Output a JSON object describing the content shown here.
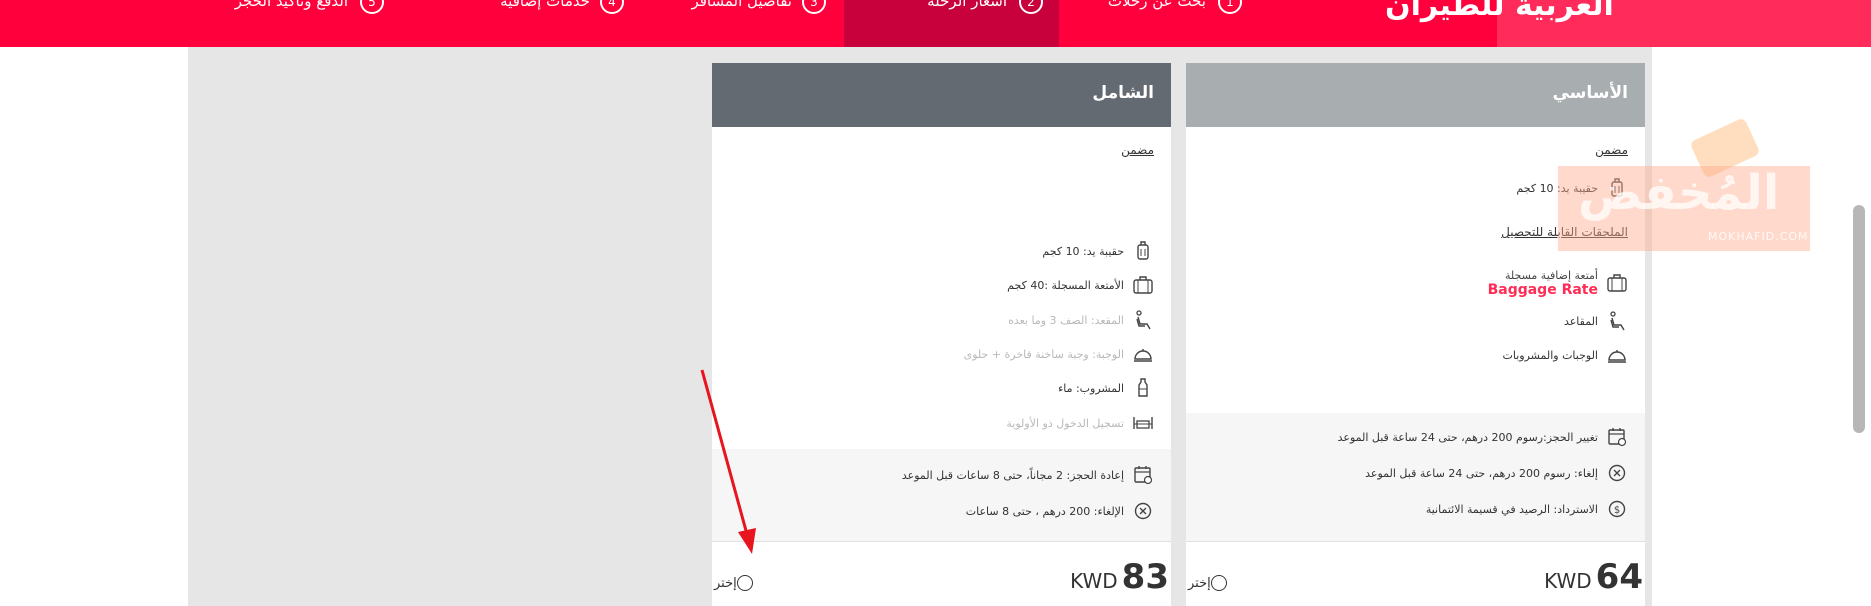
{
  "header": {
    "logo_text": "العربية للطيران",
    "steps": [
      {
        "num": "1",
        "label": "بحث عن رحلات"
      },
      {
        "num": "2",
        "label": "أسعار الرحلة"
      },
      {
        "num": "3",
        "label": "تفاصيل المسافر"
      },
      {
        "num": "4",
        "label": "خدمات إضافية"
      },
      {
        "num": "5",
        "label": "الدفع وتأكيد الحجز"
      }
    ]
  },
  "cards": {
    "inclusive": {
      "title": "الشامل",
      "included_title": "مضمن",
      "items": [
        {
          "icon": "carry-on-bag-icon",
          "label": "حقيبة يد: 10 كجم"
        },
        {
          "icon": "checked-luggage-icon",
          "label": "الأمتعة المسجلة :40 كجم"
        },
        {
          "icon": "seat-icon",
          "label": "المقعد: الصف 3 وما بعده"
        },
        {
          "icon": "meal-cloche-icon",
          "label": "الوجبة: وجبة ساخنة فاخرة + حلوى"
        },
        {
          "icon": "bottle-icon",
          "label": "المشروب: ماء"
        },
        {
          "icon": "priority-checkin-icon",
          "label": "تسجيل الدخول ذو الأولوية"
        }
      ],
      "policies": [
        {
          "icon": "calendar-change-icon",
          "label": "إعادة الحجز: 2 مجاناً، حتى 8 ساعات قبل الموعد"
        },
        {
          "icon": "cancel-circle-icon",
          "label": "الإلغاء: 200 درهم ، حتى 8 ساعات"
        }
      ],
      "price_amount": "83",
      "currency": "KWD",
      "choose_label": "إختر"
    },
    "basic": {
      "title": "الأساسي",
      "included_title": "مضمن",
      "items": [
        {
          "icon": "carry-on-bag-icon",
          "label": "حقيبة يد: 10 كجم"
        }
      ],
      "addons_title": "الملحقات القابلة للتحصيل",
      "addons": [
        {
          "icon": "checked-luggage-icon",
          "label": "أمتعة إضافية مسجلة",
          "rate_label": "Baggage Rate"
        },
        {
          "icon": "seat-icon",
          "label": "المقاعد"
        },
        {
          "icon": "meal-cloche-icon",
          "label": "الوجبات والمشروبات"
        }
      ],
      "policies": [
        {
          "icon": "calendar-change-icon",
          "label": "تغيير الحجز:رسوم 200 درهم، حتى 24 ساعة قبل الموعد"
        },
        {
          "icon": "cancel-circle-icon",
          "label": "إلغاء: رسوم 200 درهم، حتى 24 ساعة قبل الموعد"
        },
        {
          "icon": "refund-dollar-icon",
          "label": "الاسترداد: الرصيد في قسيمة الائتمانية"
        }
      ],
      "price_amount": "64",
      "currency": "KWD",
      "choose_label": "إختر"
    }
  },
  "watermark": {
    "main": "المُخفض",
    "sub": "MOKHAFID.COM"
  },
  "colors": {
    "brand_red": "#ff003c",
    "active_step": "#c8003c",
    "inclusive_header": "#636a72",
    "basic_header": "#a8adb0",
    "rate_link": "#ff2d55",
    "annotation_arrow": "#e8141e"
  }
}
